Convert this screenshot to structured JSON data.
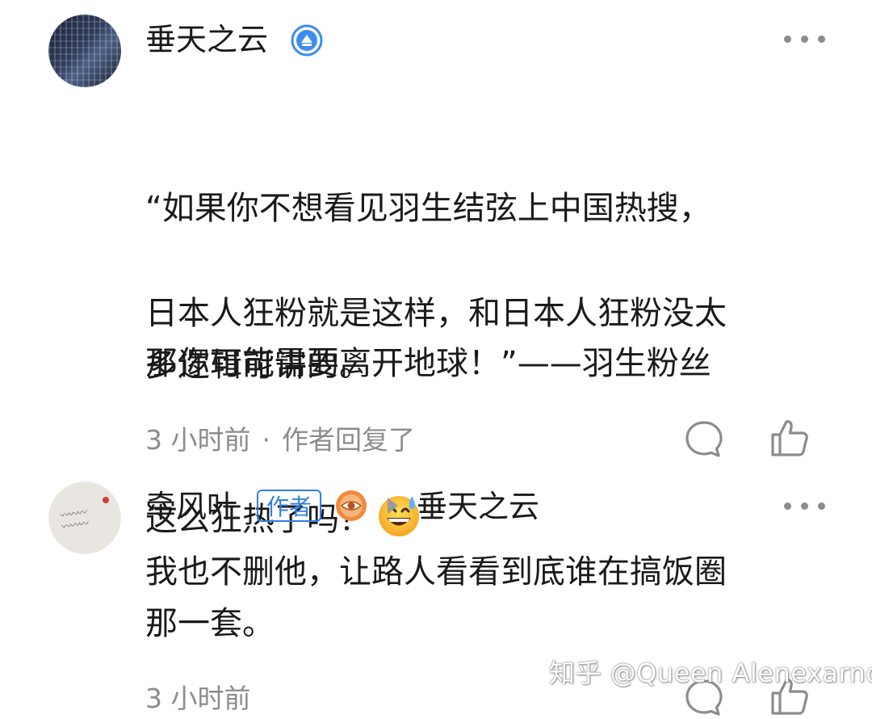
{
  "comments": [
    {
      "author": "垂天之云",
      "badge_icon": "verified-badge-icon",
      "text_line_1": "“如果你不想看见羽生结弦上中国热搜，",
      "text_line_2": "那你可能需要离开地球！”——羽生粉丝",
      "text_line_3": "这么狂热了吗？",
      "emoji": "grinning-sweat-emoji",
      "text_paragraph_2": "日本人狂粉就是这样，和日本人狂粉没太\n多逻辑可讲的。",
      "time": "3 小时前",
      "separator": "·",
      "status": "作者回复了"
    },
    {
      "author": "牵风叶",
      "author_tag": "作者",
      "reply_to": "垂天之云",
      "text": "我也不删他，让路人看看到底谁在搞饭圈\n那一套。",
      "time": "3 小时前"
    }
  ],
  "watermark": "知乎 @Queen Alenexarnd",
  "colors": {
    "accent": "#2f7fe6",
    "meta": "#8c8c8c",
    "text": "#1a1a1a"
  }
}
